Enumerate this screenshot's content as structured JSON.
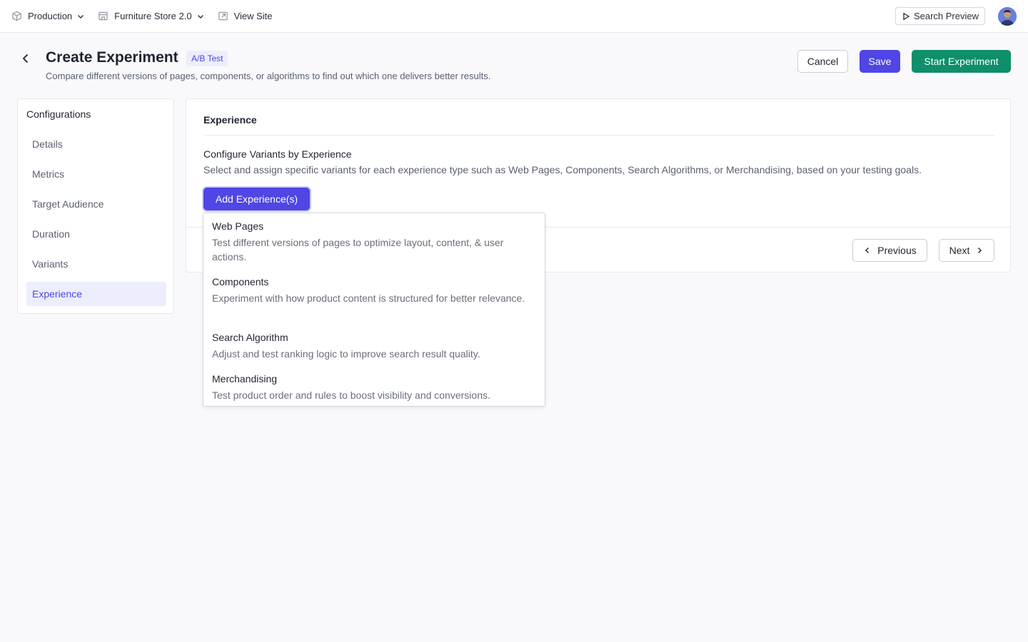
{
  "topbar": {
    "environment": "Production",
    "store": "Furniture Store 2.0",
    "view_site": "View Site",
    "search_preview": "Search Preview"
  },
  "header": {
    "title": "Create Experiment",
    "badge": "A/B Test",
    "subtitle": "Compare different versions of pages, components, or algorithms to find out which one delivers better results.",
    "cancel_label": "Cancel",
    "save_label": "Save",
    "start_label": "Start Experiment"
  },
  "sidebar": {
    "title": "Configurations",
    "items": [
      {
        "label": "Details"
      },
      {
        "label": "Metrics"
      },
      {
        "label": "Target Audience"
      },
      {
        "label": "Duration"
      },
      {
        "label": "Variants"
      },
      {
        "label": "Experience"
      }
    ],
    "active_index": 5
  },
  "main": {
    "heading": "Experience",
    "section_title": "Configure Variants by Experience",
    "section_desc": "Select and assign specific variants for each experience type such as Web Pages, Components, Search Algorithms, or Merchandising, based on your testing goals.",
    "add_button": "Add Experience(s)",
    "previous_label": "Previous",
    "next_label": "Next"
  },
  "dropdown": {
    "items": [
      {
        "title": "Web Pages",
        "desc": "Test different versions of pages to optimize layout, content, & user actions."
      },
      {
        "title": "Components",
        "desc": "Experiment with how product content is structured for better relevance."
      },
      {
        "title": "Search Algorithm",
        "desc": "Adjust and test ranking logic to improve search result quality."
      },
      {
        "title": "Merchandising",
        "desc": "Test product order and rules to boost visibility and conversions."
      }
    ]
  },
  "colors": {
    "primary": "#4f46e5",
    "success": "#0e8f6a",
    "active_bg": "#eceefd"
  }
}
